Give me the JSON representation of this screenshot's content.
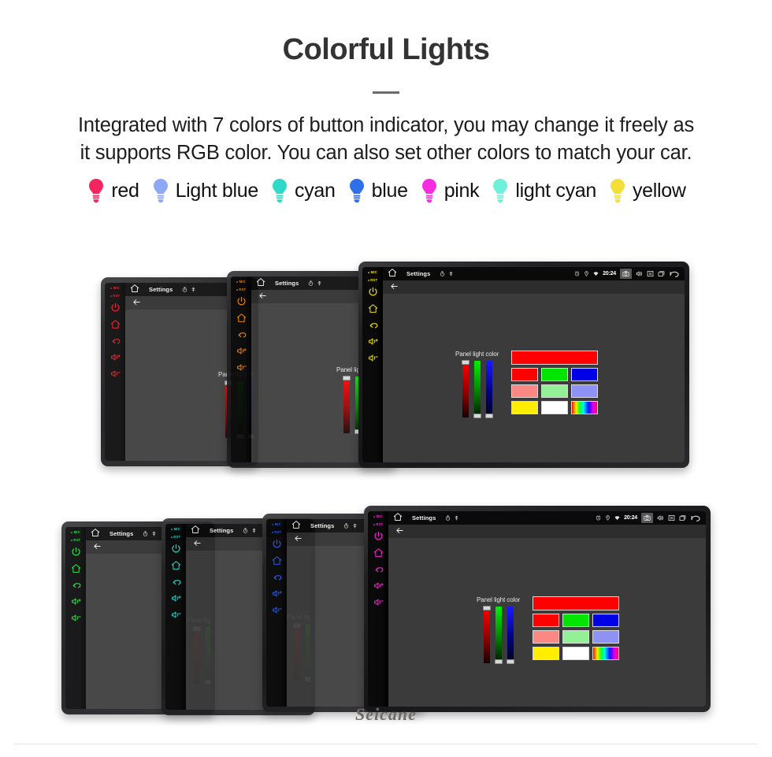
{
  "header": {
    "title": "Colorful Lights",
    "divider": "horizontal-rule",
    "description_line1": "Integrated with 7 colors of button indicator, you may change it freely as",
    "description_line2": "it supports RGB color. You can also set other colors to match your car."
  },
  "legend": {
    "icon_name": "light-bulb-icon",
    "items": [
      {
        "label": "red",
        "color": "#f4245e"
      },
      {
        "label": "Light blue",
        "color": "#8fa8f5"
      },
      {
        "label": "cyan",
        "color": "#2fd9c8"
      },
      {
        "label": "blue",
        "color": "#2f6fe8"
      },
      {
        "label": "pink",
        "color": "#f62ce0"
      },
      {
        "label": "light cyan",
        "color": "#6ff0d8"
      },
      {
        "label": "yellow",
        "color": "#f2e038"
      }
    ]
  },
  "screen_ui": {
    "statusbar": {
      "home_icon": "home-icon",
      "title": "Settings",
      "timer_icon": "timer-icon",
      "antenna_icon": "antenna-icon",
      "alarm_icon": "alarm-icon",
      "location_icon": "location-pin-icon",
      "wifi_icon": "wifi-icon",
      "clock": "20:24",
      "camera_icon": "camera-icon",
      "volume_icon": "volume-icon",
      "close_icon": "close-box-icon",
      "recents_icon": "recents-icon",
      "back_icon": "back-arrow-icon"
    },
    "appbar": {
      "back_icon": "back-arrow-icon"
    },
    "panel": {
      "label": "Panel light color",
      "sliders": [
        {
          "name": "red-slider",
          "channel": "R",
          "value": 100,
          "thumb": "top"
        },
        {
          "name": "green-slider",
          "channel": "G",
          "value": 0,
          "thumb": "bottom"
        },
        {
          "name": "blue-slider",
          "channel": "B",
          "value": 0,
          "thumb": "bottom"
        }
      ],
      "preview_color": "#ff0000",
      "swatch_rows": [
        [
          "#ff0000",
          "#00e600",
          "#0000e6"
        ],
        [
          "#fb8882",
          "#93f096",
          "#8f92f5"
        ],
        [
          "#ffee00",
          "#ffffff",
          "rainbow"
        ]
      ]
    },
    "hw_buttons": [
      {
        "name": "mic-led",
        "label": "MIC"
      },
      {
        "name": "reset-led",
        "label": "RST"
      },
      {
        "name": "power-button",
        "icon": "power-icon"
      },
      {
        "name": "home-button",
        "icon": "home-icon"
      },
      {
        "name": "back-button",
        "icon": "back-arrow-icon"
      },
      {
        "name": "volume-up-button",
        "icon": "volume-plus-icon"
      },
      {
        "name": "volume-down-button",
        "icon": "volume-minus-icon"
      }
    ]
  },
  "units": {
    "top_row": [
      {
        "id": "unit-red",
        "led_color": "#e01b24",
        "partial": true
      },
      {
        "id": "unit-orange",
        "led_color": "#f08a00",
        "partial": true
      },
      {
        "id": "unit-yellow",
        "led_color": "#f2e000",
        "partial": false
      }
    ],
    "bottom_row": [
      {
        "id": "unit-green",
        "led_color": "#19e03c",
        "partial": true
      },
      {
        "id": "unit-cyan",
        "led_color": "#1ee0d0",
        "partial": true
      },
      {
        "id": "unit-blue",
        "led_color": "#2a5cf5",
        "partial": true
      },
      {
        "id": "unit-pink",
        "led_color": "#f225cf",
        "partial": false
      }
    ]
  },
  "brand": {
    "name": "Seicane"
  }
}
